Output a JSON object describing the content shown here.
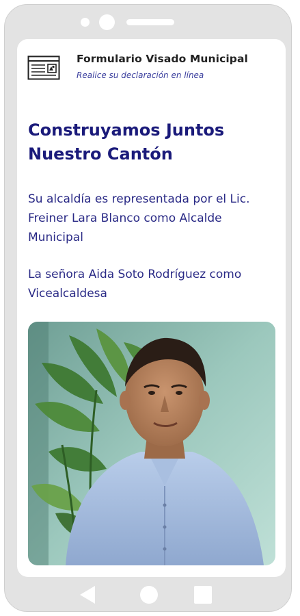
{
  "header": {
    "title": "Formulario Visado Municipal",
    "subtitle": "Realice su declaración en línea",
    "icon": "form-document-icon"
  },
  "main": {
    "title": "Construyamos Juntos Nuestro Cantón",
    "paragraph_1": "Su alcaldía es representada por el Lic. Freiner Lara Blanco como Alcalde Municipal",
    "paragraph_2": "La señora Aida Soto Rodríguez como Vicealcaldesa",
    "photo": "portrait-photo"
  },
  "device": {
    "nav": [
      "back-icon",
      "home-icon",
      "recent-apps-icon"
    ]
  },
  "colors": {
    "title": "#1a1a7a",
    "body_text": "#2a2a86",
    "subtitle": "#3b3f9e",
    "frame": "#e3e3e3"
  }
}
